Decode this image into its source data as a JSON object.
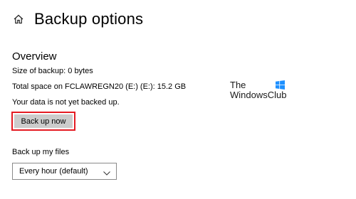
{
  "header": {
    "home_icon": "home-icon",
    "title": "Backup options"
  },
  "overview": {
    "heading": "Overview",
    "size_line": "Size of backup: 0 bytes",
    "space_line": "Total space on FCLAWREGN20 (E:) (E:): 15.2 GB",
    "status_line": "Your data is not yet backed up.",
    "backup_button_label": "Back up now"
  },
  "files": {
    "label": "Back up my files",
    "frequency_selected": "Every hour (default)",
    "chevron_icon": "chevron-down-icon"
  },
  "watermark": {
    "line1": "The",
    "line2": "WindowsClub",
    "logo_icon": "windows-logo-icon",
    "logo_color": "#1e90ff"
  },
  "colors": {
    "highlight_border": "#e41b23",
    "button_bg": "#cccccc"
  }
}
